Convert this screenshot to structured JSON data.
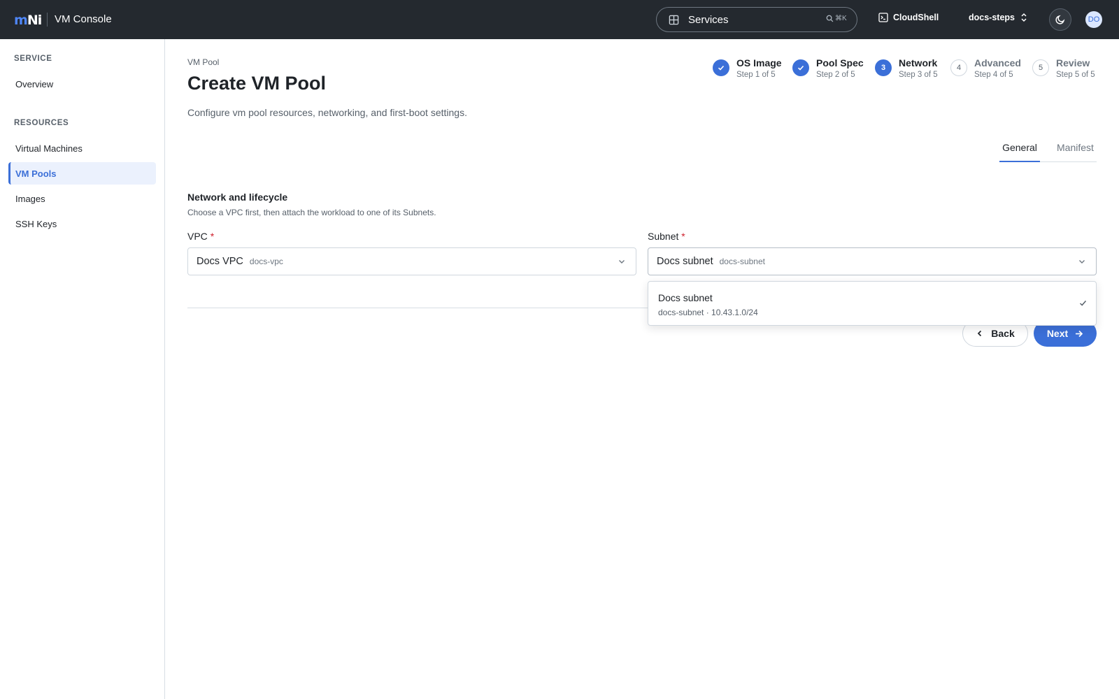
{
  "header": {
    "logo_m": "m",
    "logo_ni": "Ni",
    "app_title": "VM Console",
    "search_label": "Services",
    "search_shortcut": "⌘K",
    "cloudshell_label": "CloudShell",
    "project_name": "docs-steps",
    "avatar_initials": "DO",
    "icons": [
      "grid-icon",
      "search-icon",
      "terminal-icon",
      "chevron-up-down-icon",
      "moon-icon"
    ]
  },
  "sidebar": {
    "sections": [
      {
        "title": "SERVICE",
        "items": [
          {
            "label": "Overview",
            "active": false
          }
        ]
      },
      {
        "title": "RESOURCES",
        "items": [
          {
            "label": "Virtual Machines",
            "active": false
          },
          {
            "label": "VM Pools",
            "active": true
          },
          {
            "label": "Images",
            "active": false
          },
          {
            "label": "SSH Keys",
            "active": false
          }
        ]
      }
    ]
  },
  "page": {
    "breadcrumb": "VM Pool",
    "title": "Create VM Pool",
    "description": "Configure vm pool resources, networking, and first-boot settings."
  },
  "stepper": [
    {
      "number": "1",
      "name": "OS Image",
      "sub": "Step 1 of 5",
      "state": "done"
    },
    {
      "number": "2",
      "name": "Pool Spec",
      "sub": "Step 2 of 5",
      "state": "done"
    },
    {
      "number": "3",
      "name": "Network",
      "sub": "Step 3 of 5",
      "state": "current"
    },
    {
      "number": "4",
      "name": "Advanced",
      "sub": "Step 4 of 5",
      "state": "todo"
    },
    {
      "number": "5",
      "name": "Review",
      "sub": "Step 5 of 5",
      "state": "todo"
    }
  ],
  "tabs": [
    {
      "label": "General",
      "active": true
    },
    {
      "label": "Manifest",
      "active": false
    }
  ],
  "section": {
    "title": "Network and lifecycle",
    "description": "Choose a VPC first, then attach the workload to one of its Subnets."
  },
  "fields": {
    "vpc": {
      "label": "VPC",
      "required_mark": "*",
      "value": "Docs VPC",
      "code": "docs-vpc"
    },
    "subnet": {
      "label": "Subnet",
      "required_mark": "*",
      "value": "Docs subnet",
      "code": "docs-subnet"
    }
  },
  "subnet_menu": {
    "options": [
      {
        "title": "Docs subnet",
        "sub": "docs-subnet · 10.43.1.0/24",
        "selected": true
      }
    ]
  },
  "actions": {
    "back_label": "Back",
    "next_label": "Next"
  },
  "colors": {
    "topbar": "#24292f",
    "accent": "#3b6fd8",
    "required": "#cf222e"
  }
}
